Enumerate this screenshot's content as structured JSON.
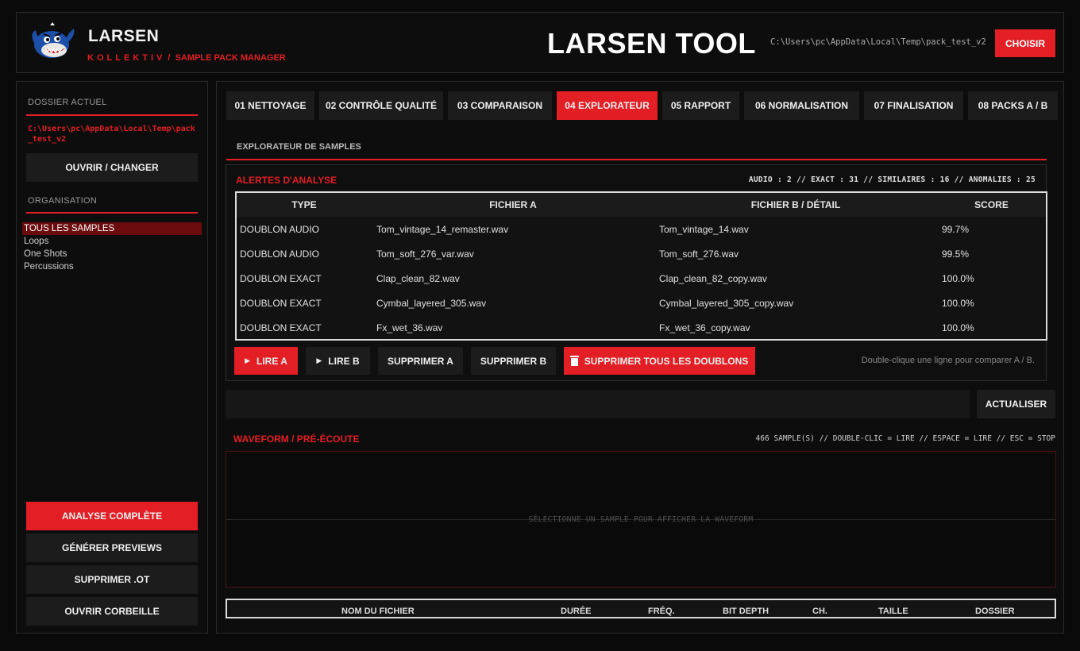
{
  "header": {
    "brand_name": "LARSEN",
    "brand_sub_a": "KOLLEKTIV",
    "brand_sub_sep": "/",
    "brand_sub_b": "SAMPLE PACK MANAGER",
    "app_title": "LARSEN TOOL",
    "path": "C:\\Users\\pc\\AppData\\Local\\Temp\\pack_test_v2",
    "choose_label": "CHOISIR"
  },
  "sidebar": {
    "current_folder_label": "DOSSIER ACTUEL",
    "current_folder_path": "C:\\Users\\pc\\AppData\\Local\\Temp\\pack_test_v2",
    "open_change_label": "OUVRIR / CHANGER",
    "organisation_label": "ORGANISATION",
    "items": [
      {
        "label": "TOUS LES SAMPLES",
        "active": true
      },
      {
        "label": "Loops",
        "active": false
      },
      {
        "label": "One Shots",
        "active": false
      },
      {
        "label": "Percussions",
        "active": false
      }
    ],
    "full_analysis_label": "ANALYSE COMPLÈTE",
    "generate_previews_label": "GÉNÉRER PREVIEWS",
    "delete_ot_label": "SUPPRIMER .OT",
    "open_trash_label": "OUVRIR CORBEILLE"
  },
  "tabs": [
    {
      "label": "01 NETTOYAGE",
      "active": false
    },
    {
      "label": "02 CONTRÔLE QUALITÉ",
      "active": false
    },
    {
      "label": "03 COMPARAISON",
      "active": false
    },
    {
      "label": "04 EXPLORATEUR",
      "active": true
    },
    {
      "label": "05 RAPPORT",
      "active": false
    },
    {
      "label": "06 NORMALISATION",
      "active": false
    },
    {
      "label": "07 FINALISATION",
      "active": false
    },
    {
      "label": "08 PACKS A / B",
      "active": false
    }
  ],
  "explorer": {
    "section_title": "EXPLORATEUR DE SAMPLES",
    "alerts_title": "ALERTES D'ANALYSE",
    "alerts_stats": "AUDIO : 2  //  EXACT : 31  //  SIMILAIRES : 16  //  ANOMALIES : 25",
    "columns": [
      "TYPE",
      "FICHIER A",
      "FICHIER B / DÉTAIL",
      "SCORE"
    ],
    "rows": [
      [
        "DOUBLON AUDIO",
        "Tom_vintage_14_remaster.wav",
        "Tom_vintage_14.wav",
        "99.7%"
      ],
      [
        "DOUBLON AUDIO",
        "Tom_soft_276_var.wav",
        "Tom_soft_276.wav",
        "99.5%"
      ],
      [
        "DOUBLON EXACT",
        "Clap_clean_82.wav",
        "Clap_clean_82_copy.wav",
        "100.0%"
      ],
      [
        "DOUBLON EXACT",
        "Cymbal_layered_305.wav",
        "Cymbal_layered_305_copy.wav",
        "100.0%"
      ],
      [
        "DOUBLON EXACT",
        "Fx_wet_36.wav",
        "Fx_wet_36_copy.wav",
        "100.0%"
      ]
    ],
    "play_a_label": "LIRE A",
    "play_b_label": "LIRE B",
    "delete_a_label": "SUPPRIMER A",
    "delete_b_label": "SUPPRIMER B",
    "delete_all_label": "SUPPRIMER TOUS LES DOUBLONS",
    "hint": "Double-clique une ligne pour comparer A / B.",
    "refresh_label": "ACTUALISER",
    "waveform_title": "WAVEFORM / PRÉ-ÉCOUTE",
    "waveform_info": "466 SAMPLE(S)  //  DOUBLE-CLIC = LIRE  //  ESPACE = LIRE  //  ESC = STOP",
    "waveform_placeholder": "SÉLECTIONNE UN SAMPLE POUR AFFICHER LA WAVEFORM",
    "file_columns": [
      "NOM DU FICHIER",
      "DURÉE",
      "FRÉQ.",
      "BIT DEPTH",
      "CH.",
      "TAILLE",
      "DOSSIER"
    ]
  },
  "colors": {
    "accent": "#e31e24",
    "bg": "#0a0a0a",
    "panel": "#0d0d0d",
    "button": "#1c1c1c"
  }
}
